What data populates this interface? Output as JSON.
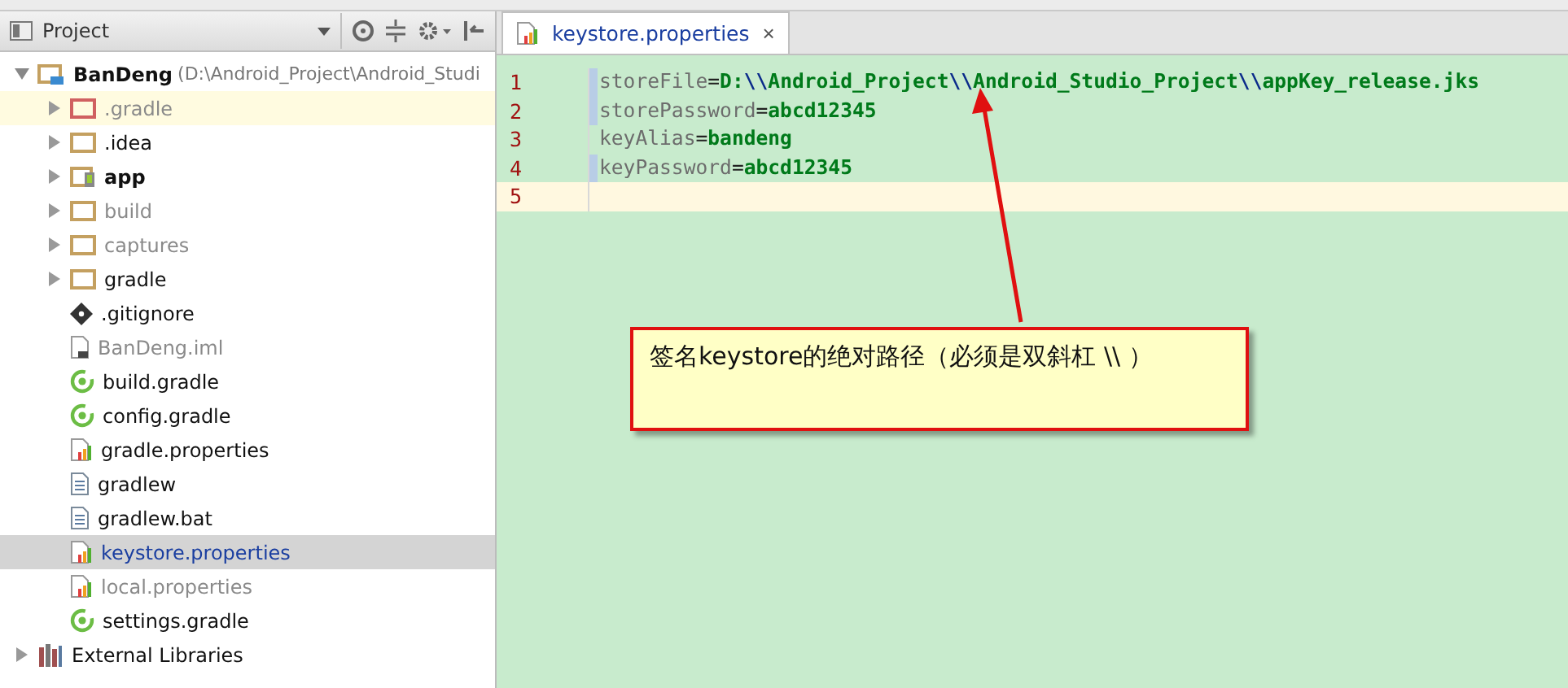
{
  "project_panel": {
    "title": "Project",
    "tree": [
      {
        "label": "BanDeng",
        "path": "(D:\\Android_Project\\Android_Studi",
        "kind": "module",
        "bold": true,
        "muted": false,
        "expanded": true,
        "highlighted": false,
        "selected": false,
        "children": [
          {
            "label": ".gradle",
            "kind": "folder-excluded",
            "bold": false,
            "muted": true,
            "expanded": false,
            "highlighted": true,
            "selected": false
          },
          {
            "label": ".idea",
            "kind": "folder",
            "bold": false,
            "muted": false,
            "expanded": false,
            "highlighted": false,
            "selected": false
          },
          {
            "label": "app",
            "kind": "folder-app",
            "bold": true,
            "muted": false,
            "expanded": false,
            "highlighted": false,
            "selected": false
          },
          {
            "label": "build",
            "kind": "folder",
            "bold": false,
            "muted": true,
            "expanded": false,
            "highlighted": false,
            "selected": false
          },
          {
            "label": "captures",
            "kind": "folder",
            "bold": false,
            "muted": true,
            "expanded": false,
            "highlighted": false,
            "selected": false
          },
          {
            "label": "gradle",
            "kind": "folder",
            "bold": false,
            "muted": false,
            "expanded": false,
            "highlighted": false,
            "selected": false
          },
          {
            "label": ".gitignore",
            "kind": "git",
            "bold": false,
            "muted": false,
            "highlighted": false,
            "selected": false
          },
          {
            "label": "BanDeng.iml",
            "kind": "iml",
            "bold": false,
            "muted": true,
            "highlighted": false,
            "selected": false
          },
          {
            "label": "build.gradle",
            "kind": "gradle",
            "bold": false,
            "muted": false,
            "highlighted": false,
            "selected": false
          },
          {
            "label": "config.gradle",
            "kind": "gradle",
            "bold": false,
            "muted": false,
            "highlighted": false,
            "selected": false
          },
          {
            "label": "gradle.properties",
            "kind": "properties",
            "bold": false,
            "muted": false,
            "highlighted": false,
            "selected": false
          },
          {
            "label": "gradlew",
            "kind": "text",
            "bold": false,
            "muted": false,
            "highlighted": false,
            "selected": false
          },
          {
            "label": "gradlew.bat",
            "kind": "text",
            "bold": false,
            "muted": false,
            "highlighted": false,
            "selected": false
          },
          {
            "label": "keystore.properties",
            "kind": "properties",
            "bold": false,
            "muted": false,
            "highlighted": false,
            "selected": true
          },
          {
            "label": "local.properties",
            "kind": "properties",
            "bold": false,
            "muted": true,
            "highlighted": false,
            "selected": false
          },
          {
            "label": "settings.gradle",
            "kind": "gradle",
            "bold": false,
            "muted": false,
            "highlighted": false,
            "selected": false
          }
        ]
      },
      {
        "label": "External Libraries",
        "kind": "library",
        "bold": false,
        "muted": false,
        "expanded": false,
        "highlighted": false,
        "selected": false
      }
    ]
  },
  "editor": {
    "tab": {
      "label": "keystore.properties",
      "close": "×"
    },
    "lines": [
      {
        "number": "1",
        "changed": true,
        "current": false,
        "segments": [
          {
            "kind": "key",
            "text": "storeFile"
          },
          {
            "kind": "sep",
            "text": "="
          },
          {
            "kind": "value",
            "text": "D:"
          },
          {
            "kind": "escape",
            "text": "\\\\"
          },
          {
            "kind": "value",
            "text": "Android_Project"
          },
          {
            "kind": "escape",
            "text": "\\\\"
          },
          {
            "kind": "value",
            "text": "Android_Studio_Project"
          },
          {
            "kind": "escape",
            "text": "\\\\"
          },
          {
            "kind": "value",
            "text": "appKey_release.jks"
          }
        ]
      },
      {
        "number": "2",
        "changed": true,
        "current": false,
        "segments": [
          {
            "kind": "key",
            "text": "storePassword"
          },
          {
            "kind": "sep",
            "text": "="
          },
          {
            "kind": "value",
            "text": "abcd12345"
          }
        ]
      },
      {
        "number": "3",
        "changed": false,
        "current": false,
        "segments": [
          {
            "kind": "key",
            "text": "keyAlias"
          },
          {
            "kind": "sep",
            "text": "="
          },
          {
            "kind": "value",
            "text": "bandeng"
          }
        ]
      },
      {
        "number": "4",
        "changed": true,
        "current": false,
        "segments": [
          {
            "kind": "key",
            "text": "keyPassword"
          },
          {
            "kind": "sep",
            "text": "="
          },
          {
            "kind": "value",
            "text": "abcd12345"
          }
        ]
      },
      {
        "number": "5",
        "changed": false,
        "current": true
      }
    ]
  },
  "annotation": {
    "text": "签名keystore的绝对路径（必须是双斜杠 \\\\ ）"
  }
}
